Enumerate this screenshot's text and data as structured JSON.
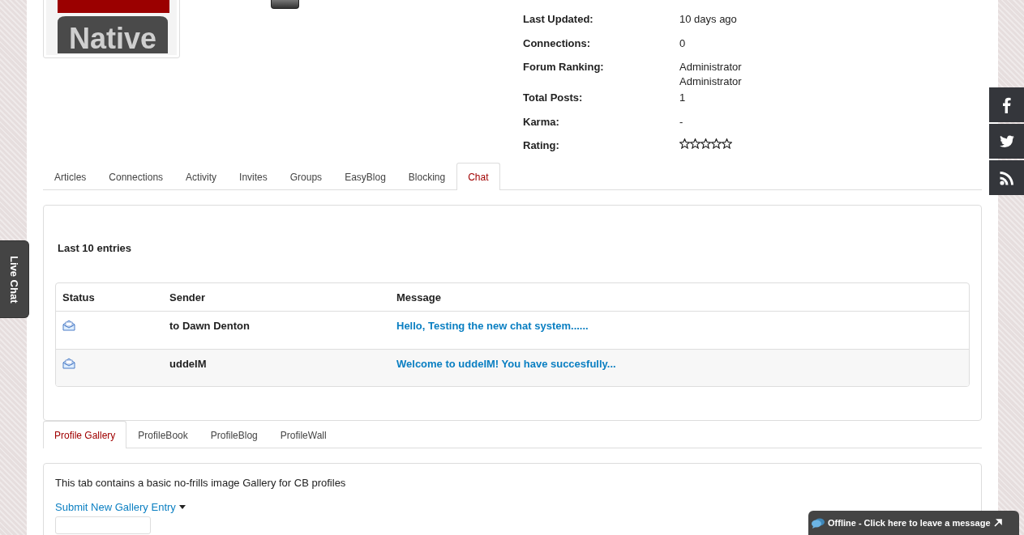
{
  "profile": {
    "logo_text": "Native",
    "fields": [
      {
        "label": "Last Updated:",
        "values": [
          "10 days ago"
        ]
      },
      {
        "label": "Connections:",
        "values": [
          "0"
        ]
      },
      {
        "label": "Forum Ranking:",
        "values": [
          "Administrator",
          "Administrator"
        ]
      },
      {
        "label": "Total Posts:",
        "values": [
          "1"
        ]
      },
      {
        "label": "Karma:",
        "values": [
          "-"
        ]
      },
      {
        "label": "Rating:",
        "kind": "stars",
        "stars": 0
      }
    ]
  },
  "tabs": [
    {
      "label": "Articles",
      "selected": false
    },
    {
      "label": "Connections",
      "selected": false
    },
    {
      "label": "Activity",
      "selected": false
    },
    {
      "label": "Invites",
      "selected": false
    },
    {
      "label": "Groups",
      "selected": false
    },
    {
      "label": "EasyBlog",
      "selected": false
    },
    {
      "label": "Blocking",
      "selected": false
    },
    {
      "label": "Chat",
      "selected": true
    }
  ],
  "chat": {
    "heading": "Last 10 entries",
    "columns": [
      "Status",
      "Sender",
      "Message"
    ],
    "rows": [
      {
        "sender": "to Dawn Denton",
        "message": "Hello, Testing the new chat system......"
      },
      {
        "sender": "uddeIM",
        "message": "Welcome to uddeIM! You have succesfully..."
      }
    ]
  },
  "gallery_tabs": [
    {
      "label": "Profile Gallery",
      "selected": true
    },
    {
      "label": "ProfileBook",
      "selected": false
    },
    {
      "label": "ProfileBlog",
      "selected": false
    },
    {
      "label": "ProfileWall",
      "selected": false
    }
  ],
  "gallery": {
    "description": "This tab contains a basic no-frills image Gallery for CB profiles",
    "submit_link": "Submit New Gallery Entry"
  },
  "live_chat": {
    "label": "Live Chat"
  },
  "social": [
    {
      "kind": "facebook"
    },
    {
      "kind": "twitter"
    },
    {
      "kind": "rss"
    }
  ],
  "offline_bar": {
    "text": "Offline - Click here to leave a message"
  }
}
